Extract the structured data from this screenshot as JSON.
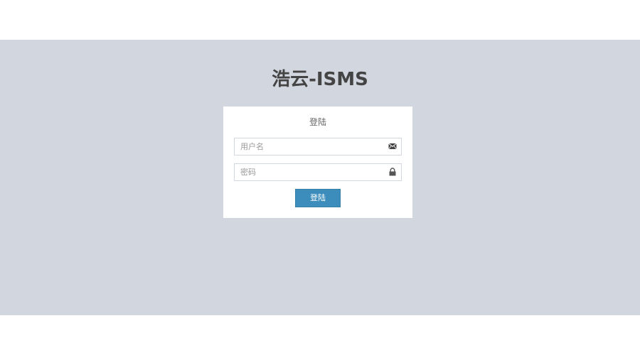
{
  "app": {
    "title": "浩云-ISMS"
  },
  "login": {
    "heading": "登陆",
    "username": {
      "placeholder": "用户名",
      "value": "",
      "icon": "envelope-icon"
    },
    "password": {
      "placeholder": "密码",
      "value": "",
      "icon": "lock-icon"
    },
    "submit_label": "登陆"
  },
  "colors": {
    "background": "#d2d6de",
    "panel": "#ffffff",
    "primary_button": "#3c8dbc",
    "title_text": "#444444"
  }
}
